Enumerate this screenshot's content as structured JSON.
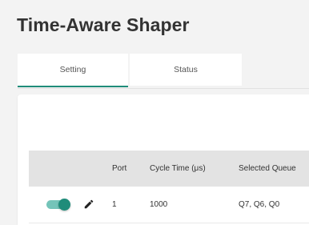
{
  "page": {
    "title": "Time-Aware Shaper"
  },
  "tabs": [
    {
      "label": "Setting",
      "active": true
    },
    {
      "label": "Status",
      "active": false
    }
  ],
  "table": {
    "columns": [
      "",
      "Port",
      "Cycle Time (μs)",
      "Selected Queue"
    ],
    "rows": [
      {
        "enabled": true,
        "port": "1",
        "cycle_time": "1000",
        "selected_queue": "Q7, Q6, Q0"
      }
    ]
  },
  "icons": {
    "edit": "pencil-icon",
    "toggle": "toggle-switch"
  },
  "colors": {
    "accent": "#1f8c7a",
    "toggle_track": "#74c4b9",
    "header_bg": "#e3e3e3"
  }
}
